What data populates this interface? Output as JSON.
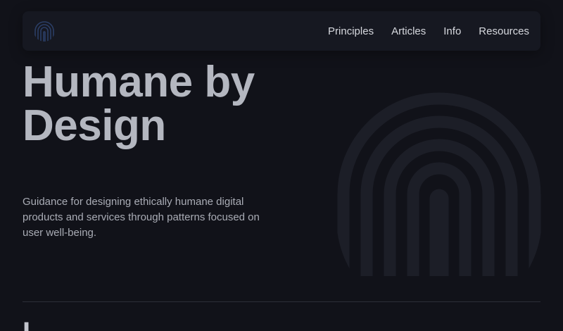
{
  "nav": {
    "logo_icon": "fingerprint-icon",
    "links": [
      {
        "label": "Principles"
      },
      {
        "label": "Articles"
      },
      {
        "label": "Info"
      },
      {
        "label": "Resources"
      }
    ]
  },
  "hero": {
    "title_line1": "Humane by",
    "title_line2": "Design",
    "description": "Guidance for designing ethically humane digital products and services through patterns focused on user well-being.",
    "illustration_icon": "fingerprint-icon"
  },
  "next_section": {
    "partial_heading": "I"
  },
  "colors": {
    "background": "#111219",
    "nav_background": "#161821",
    "title": "#b4b7c0",
    "text": "#a9acb5",
    "fingerprint": "#1c1e27",
    "logo": "#2b3e66"
  }
}
